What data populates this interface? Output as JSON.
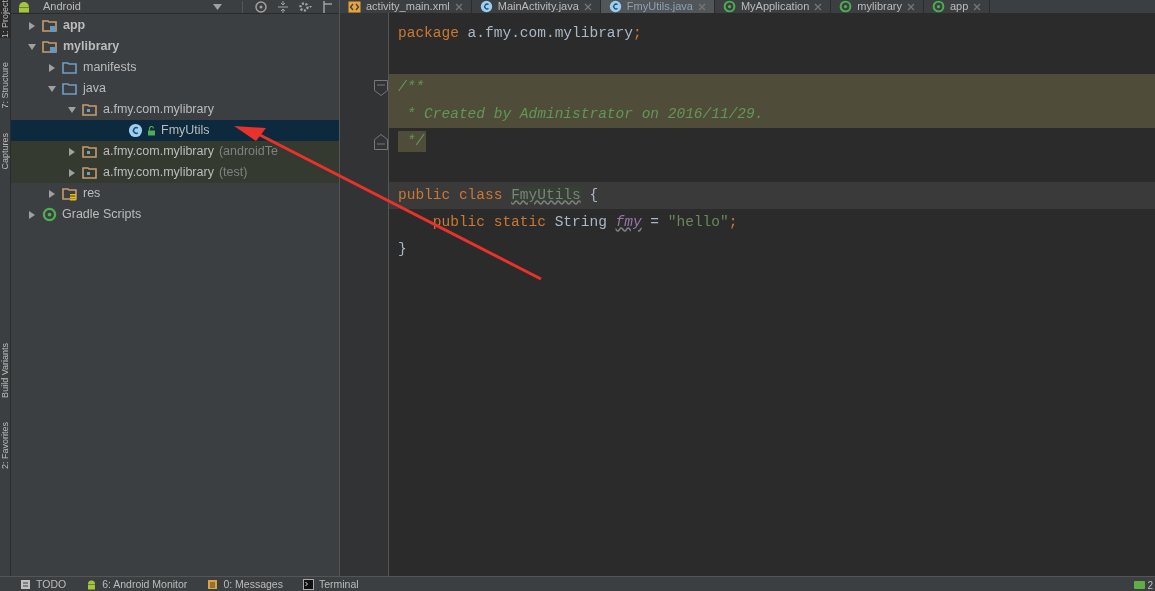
{
  "side_strip": [
    {
      "label": "1: Project",
      "selected": true
    },
    {
      "label": "7: Structure",
      "selected": false
    },
    {
      "label": "Captures",
      "selected": false
    },
    {
      "label": "Build Variants",
      "selected": false
    },
    {
      "label": "2: Favorites",
      "selected": false
    }
  ],
  "project_panel": {
    "view": "Android",
    "tree": [
      {
        "label": "app",
        "kind": "module",
        "expanded": false
      },
      {
        "label": "mylibrary",
        "kind": "module",
        "expanded": true,
        "children": [
          {
            "label": "manifests",
            "kind": "folder",
            "expanded": false
          },
          {
            "label": "java",
            "kind": "folder",
            "expanded": true,
            "children": [
              {
                "label": "a.fmy.com.mylibrary",
                "kind": "package",
                "expanded": true,
                "test_source": false,
                "children": [
                  {
                    "label": "FmyUtils",
                    "kind": "class",
                    "selected": true
                  }
                ]
              },
              {
                "label": "a.fmy.com.mylibrary",
                "suffix": "(androidTe",
                "kind": "package",
                "expanded": false,
                "test_source": true
              },
              {
                "label": "a.fmy.com.mylibrary",
                "suffix": "(test)",
                "kind": "package",
                "expanded": false,
                "test_source": true
              }
            ]
          },
          {
            "label": "res",
            "kind": "res",
            "expanded": false
          }
        ]
      },
      {
        "label": "Gradle Scripts",
        "kind": "gradle",
        "expanded": false
      }
    ]
  },
  "tabs": [
    {
      "label": "activity_main.xml",
      "kind": "xml",
      "selected": false
    },
    {
      "label": "MainActivity.java",
      "kind": "class",
      "selected": false
    },
    {
      "label": "FmyUtils.java",
      "kind": "class",
      "selected": true
    },
    {
      "label": "MyApplication",
      "kind": "run",
      "selected": false
    },
    {
      "label": "mylibrary",
      "kind": "run",
      "selected": false
    },
    {
      "label": "app",
      "kind": "run",
      "selected": false
    }
  ],
  "editor": {
    "lines": [
      {
        "kind": "code",
        "tokens": [
          {
            "text": "package",
            "kind": "keyword"
          },
          {
            "text": " a.fmy.com.mylibrary",
            "kind": "plain"
          },
          {
            "text": ";",
            "kind": "keyword"
          }
        ]
      },
      {
        "kind": "blank"
      },
      {
        "kind": "doc_open",
        "tokens": [
          {
            "text": "/**",
            "kind": "comment"
          }
        ]
      },
      {
        "kind": "doc_body",
        "tokens": [
          {
            "text": " * Created by Administrator on 2016/11/29.",
            "kind": "comment"
          }
        ]
      },
      {
        "kind": "doc_close",
        "tokens": [
          {
            "text": " */",
            "kind": "comment"
          }
        ]
      },
      {
        "kind": "blank"
      },
      {
        "kind": "code",
        "current": true,
        "tokens": [
          {
            "text": "public class ",
            "kind": "keyword"
          },
          {
            "text": "FmyUtils",
            "kind": "unused"
          },
          {
            "text": " {",
            "kind": "plain"
          }
        ]
      },
      {
        "kind": "code",
        "tokens": [
          {
            "text": "    public static ",
            "kind": "keyword"
          },
          {
            "text": "String ",
            "kind": "plain"
          },
          {
            "text": "fmy",
            "kind": "field"
          },
          {
            "text": " = ",
            "kind": "plain"
          },
          {
            "text": "\"hello\"",
            "kind": "string"
          },
          {
            "text": ";",
            "kind": "keyword"
          }
        ]
      },
      {
        "kind": "code",
        "tokens": [
          {
            "text": "}",
            "kind": "plain"
          }
        ]
      }
    ]
  },
  "bottom_tools": [
    {
      "label": "TODO",
      "kind": "todo"
    },
    {
      "label": "6: Android Monitor",
      "kind": "android"
    },
    {
      "label": "0: Messages",
      "kind": "messages"
    },
    {
      "label": "Terminal",
      "kind": "terminal"
    }
  ],
  "event_log": {
    "count": "2"
  }
}
